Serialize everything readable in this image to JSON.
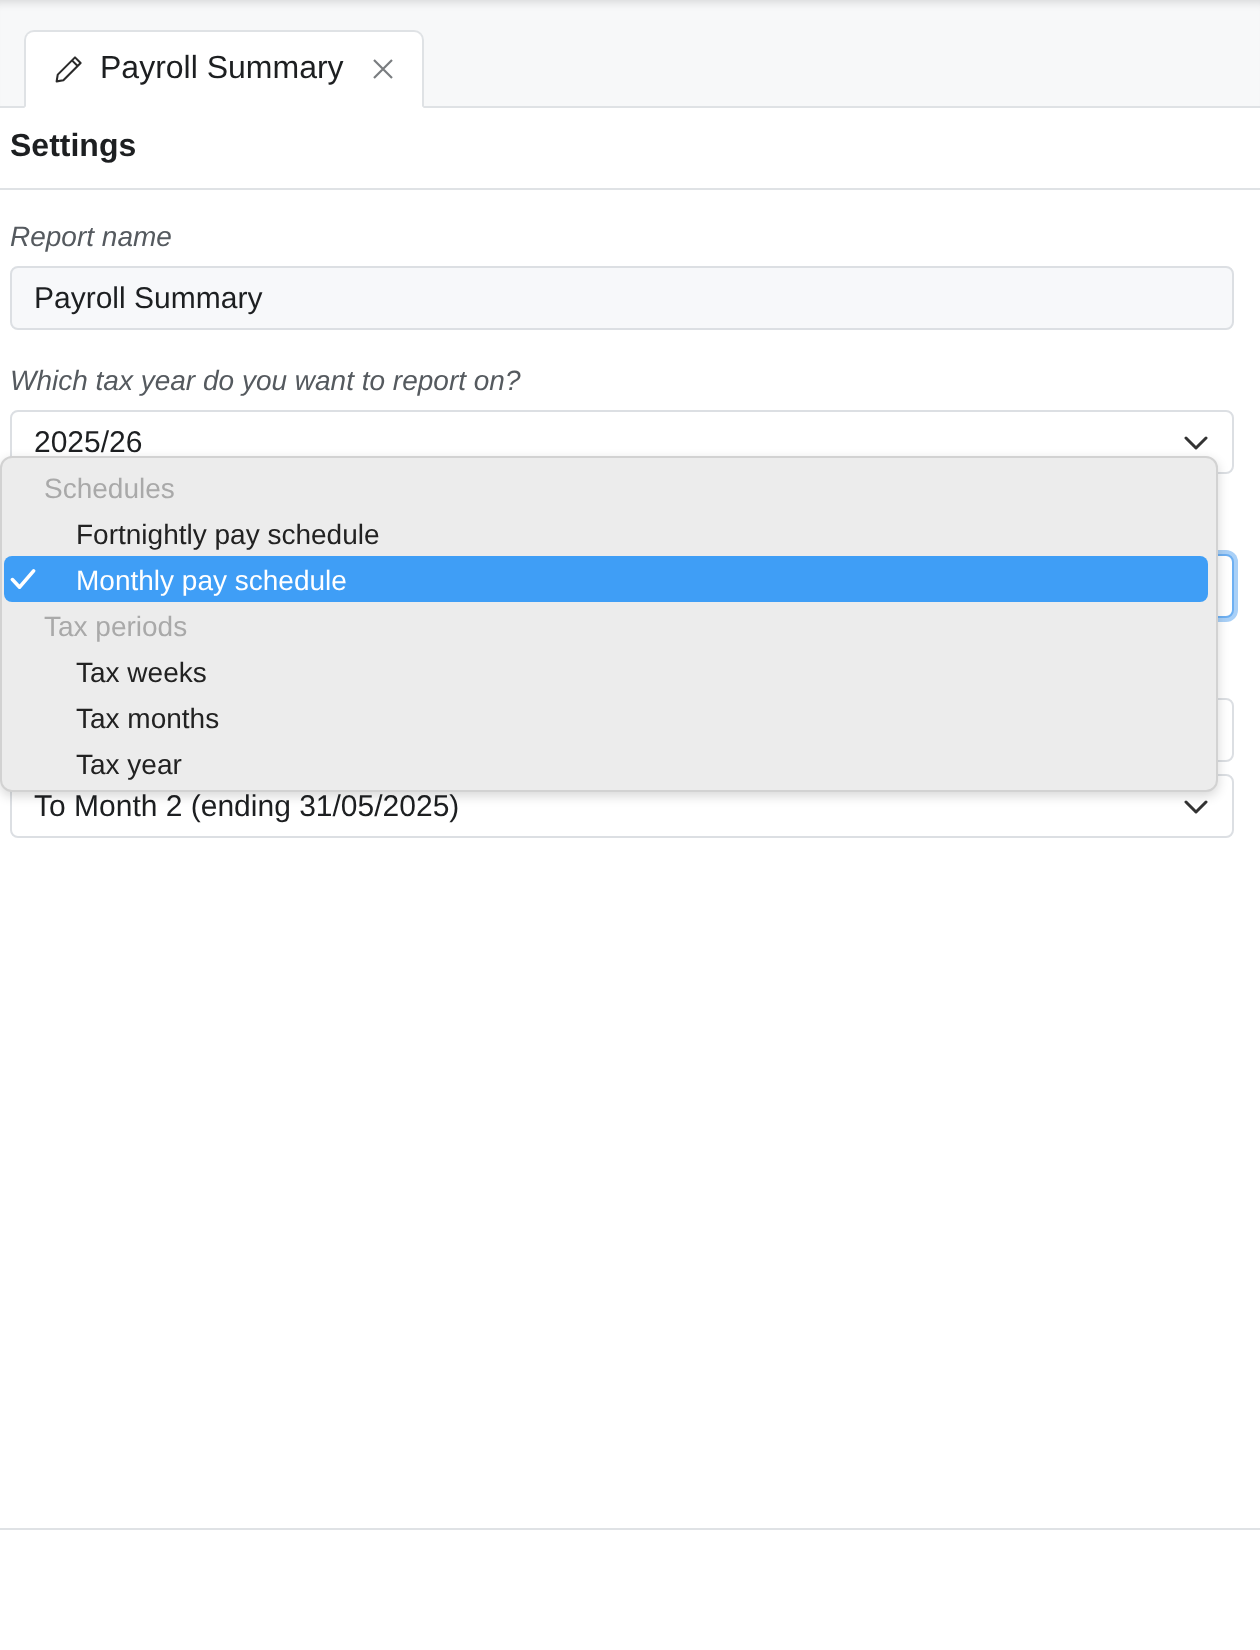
{
  "tabs": [
    {
      "label": "Payroll Summary",
      "selected": true
    }
  ],
  "panel": {
    "title": "Settings"
  },
  "sections": [
    {
      "label": "Report name",
      "fields": [
        {
          "kind": "text",
          "value": "Payroll Summary"
        }
      ]
    },
    {
      "label": "Which tax year do you want to report on?",
      "fields": [
        {
          "kind": "select",
          "value": "2025/26",
          "focused": false
        }
      ]
    },
    {
      "fields": [
        {
          "kind": "select",
          "focused": true
        }
      ]
    },
    {
      "fields": [
        {
          "kind": "select",
          "focused": false
        },
        {
          "kind": "select",
          "value": "To Month 2 (ending 31/05/2025)",
          "focused": false
        }
      ]
    }
  ],
  "menu": {
    "groups": [
      {
        "label": "Schedules",
        "options": [
          {
            "label": "Fortnightly pay schedule",
            "selected": false
          },
          {
            "label": "Monthly pay schedule",
            "selected": true
          }
        ]
      },
      {
        "label": "Tax periods",
        "options": [
          {
            "label": "Tax weeks",
            "selected": false
          },
          {
            "label": "Tax months",
            "selected": false
          },
          {
            "label": "Tax year",
            "selected": false
          }
        ]
      }
    ]
  }
}
